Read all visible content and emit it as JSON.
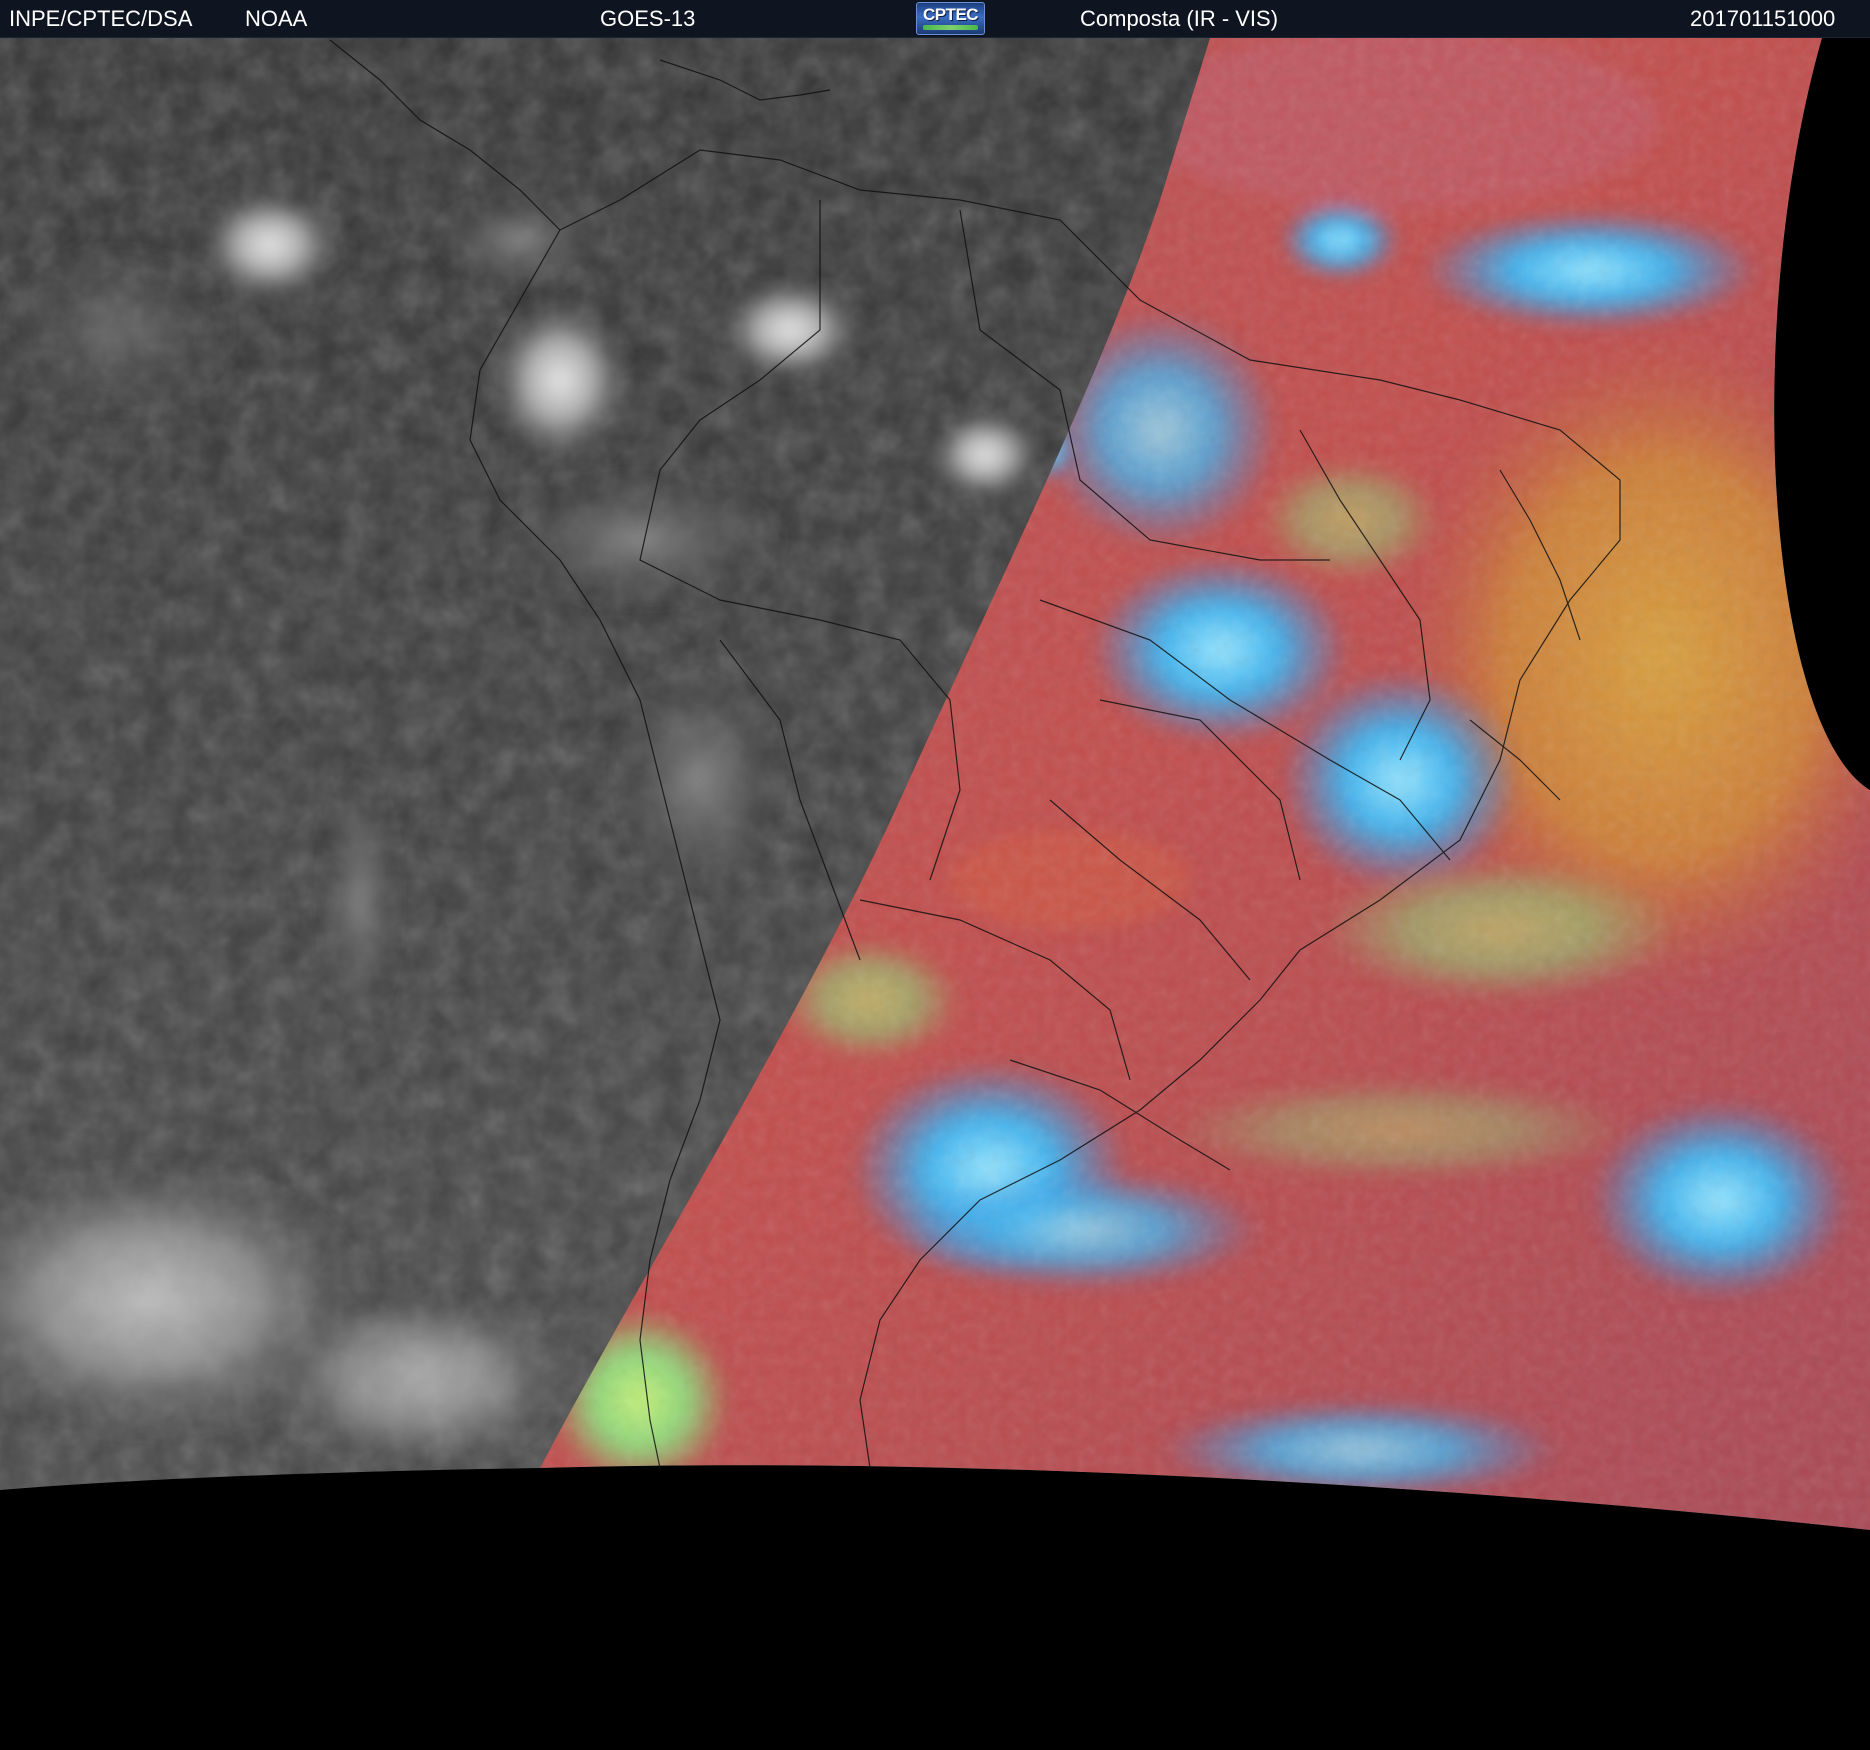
{
  "header": {
    "organization": "INPE/CPTEC/DSA",
    "agency": "NOAA",
    "satellite": "GOES-13",
    "logo_text": "CPTEC",
    "product": "Composta (IR - VIS)",
    "timestamp": "201701151000"
  },
  "colors": {
    "header_bg": "#0e1521",
    "header_text": "#ffffff",
    "ir_night_gray": "#3c3c3c",
    "vis_red": "#c24e4e",
    "cloud_cyan": "#3fb4f0",
    "cloud_green": "#9be07a",
    "ocean_orange": "#d08a3a",
    "background": "#000000"
  }
}
